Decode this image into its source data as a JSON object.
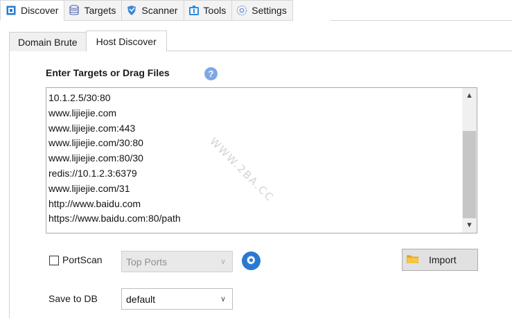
{
  "main_tabs": [
    {
      "label": "Discover",
      "icon": "discover-square-icon",
      "active": true
    },
    {
      "label": "Targets",
      "icon": "database-icon",
      "active": false
    },
    {
      "label": "Scanner",
      "icon": "shield-icon",
      "active": false
    },
    {
      "label": "Tools",
      "icon": "toolbox-icon",
      "active": false
    },
    {
      "label": "Settings",
      "icon": "settings-gear-icon",
      "active": false
    }
  ],
  "sub_tabs": [
    {
      "label": "Domain Brute",
      "active": false
    },
    {
      "label": "Host Discover",
      "active": true
    }
  ],
  "heading": "Enter Targets or Drag Files",
  "help_glyph": "?",
  "targets": [
    "10.1.2.5/30:80",
    "www.lijiejie.com",
    "www.lijiejie.com:443",
    "www.lijiejie.com/30:80",
    "www.lijiejie.com:80/30",
    "redis://10.1.2.3:6379",
    "www.lijiejie.com/31",
    "http://www.baidu.com",
    "https://www.baidu.com:80/path"
  ],
  "watermark": "WWW.2BA.CC",
  "portscan": {
    "label": "PortScan",
    "checked": false
  },
  "ports_select": {
    "value": "Top Ports",
    "enabled": false
  },
  "import_label": "Import",
  "save": {
    "label": "Save to DB",
    "value": "default"
  },
  "colors": {
    "accent": "#2a79d1",
    "help": "#7ea7e8",
    "folder": "#f2b530"
  }
}
